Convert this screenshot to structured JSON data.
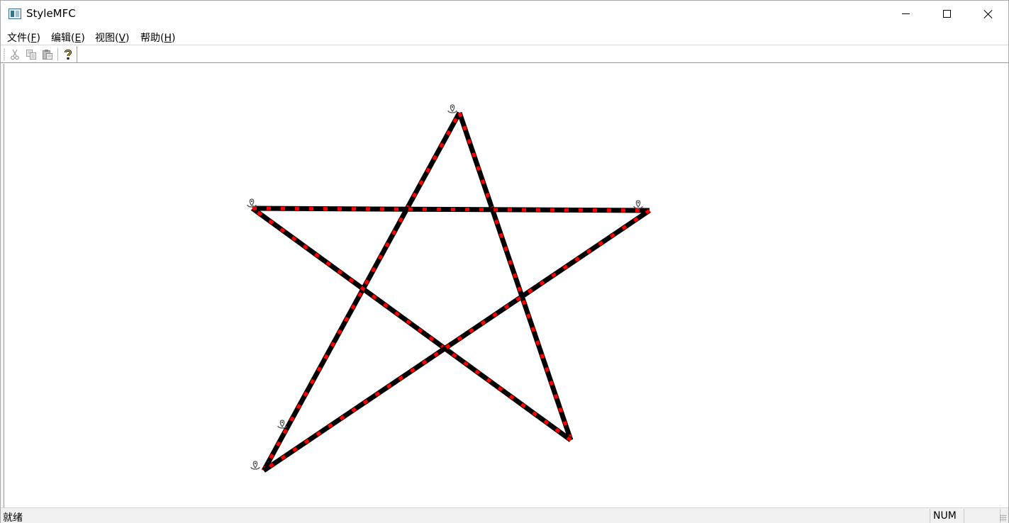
{
  "window": {
    "title": "StyleMFC"
  },
  "menubar": {
    "items": [
      {
        "label": "文件(",
        "accel": "F",
        "close": ")"
      },
      {
        "label": "编辑(",
        "accel": "E",
        "close": ")"
      },
      {
        "label": "视图(",
        "accel": "V",
        "close": ")"
      },
      {
        "label": "帮助(",
        "accel": "H",
        "close": ")"
      }
    ]
  },
  "toolbar": {
    "buttons": [
      "cut-icon",
      "copy-icon",
      "paste-icon",
      "help-icon"
    ]
  },
  "drawing": {
    "shape": "pentagram",
    "line_color": "#000000",
    "dash_color": "#ff0000",
    "marker_icon": "location-pin-icon"
  },
  "statusbar": {
    "text": "就绪",
    "num_indicator": "NUM"
  }
}
